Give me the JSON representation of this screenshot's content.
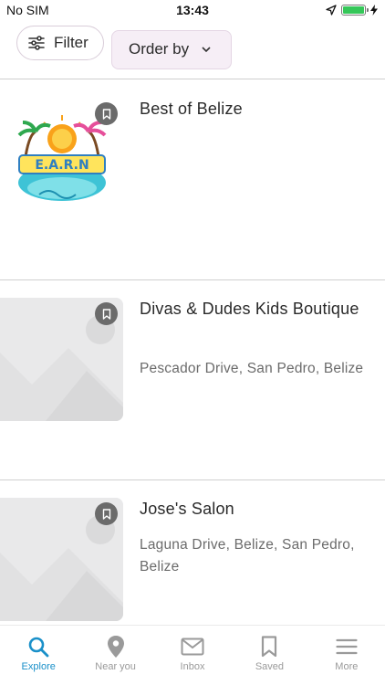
{
  "status_bar": {
    "carrier": "No SIM",
    "time": "13:43"
  },
  "toolbar": {
    "filter_label": "Filter",
    "order_label": "Order by"
  },
  "items": [
    {
      "title": "Best of Belize",
      "address": "",
      "has_logo": true,
      "logo_text": "E.A.R.N"
    },
    {
      "title": "Divas & Dudes Kids Boutique",
      "address": "Pescador Drive, San Pedro, Belize",
      "has_logo": false
    },
    {
      "title": "Jose's Salon",
      "address": "Laguna Drive, Belize, San Pedro, Belize",
      "has_logo": false
    }
  ],
  "bottom_nav": {
    "explore": "Explore",
    "near_you": "Near you",
    "inbox": "Inbox",
    "saved": "Saved",
    "more": "More"
  },
  "colors": {
    "accent": "#1a90c9",
    "inactive": "#9a9a9a",
    "battery": "#35c759"
  }
}
